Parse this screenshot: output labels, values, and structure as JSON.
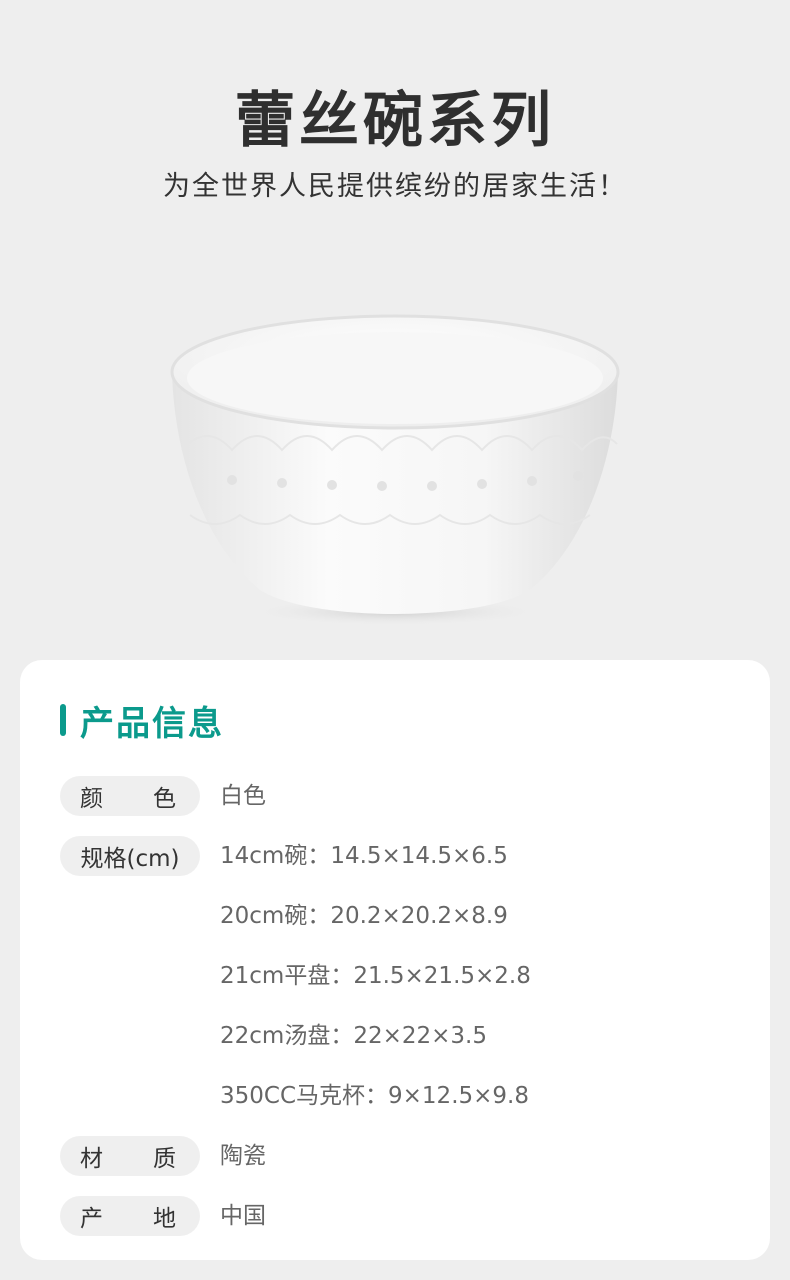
{
  "header": {
    "title": "蕾丝碗系列",
    "subtitle": "为全世界人民提供缤纷的居家生活！"
  },
  "product_info": {
    "section_title": "产品信息",
    "color": {
      "label_a": "颜",
      "label_b": "色",
      "value": "白色"
    },
    "spec": {
      "label": "规格(cm)",
      "items": [
        "14cm碗：14.5×14.5×6.5",
        "20cm碗：20.2×20.2×8.9",
        "21cm平盘：21.5×21.5×2.8",
        "22cm汤盘：22×22×3.5",
        "350CC马克杯：9×12.5×9.8"
      ]
    },
    "material": {
      "label_a": "材",
      "label_b": "质",
      "value": "陶瓷"
    },
    "origin": {
      "label_a": "产",
      "label_b": "地",
      "value": "中国"
    }
  },
  "colors": {
    "accent": "#0b9a8c",
    "background": "#eeeeee",
    "card": "#ffffff",
    "pill": "#efefef"
  }
}
